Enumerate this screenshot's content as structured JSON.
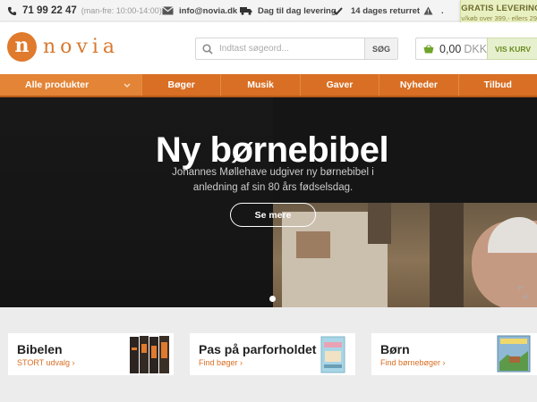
{
  "topbar": {
    "phone": "71 99 22 47",
    "hours": "(man-fre: 10:00-14:00)",
    "email": "info@novia.dk",
    "delivery": "Dag til dag levering",
    "returns": "14 dages returret",
    "extra": "."
  },
  "free_delivery": {
    "title": "GRATIS LEVERING",
    "subtitle": "v/køb over 399,- ellers 29,-"
  },
  "logo": {
    "mark": "n",
    "text": "novia"
  },
  "search": {
    "placeholder": "Indtast søgeord...",
    "button": "SØG"
  },
  "cart": {
    "amount": "0,00",
    "currency": "DKK",
    "button": "VIS KURV"
  },
  "nav": {
    "all_products": "Alle produkter",
    "links": [
      "Bøger",
      "Musik",
      "Gaver",
      "Nyheder",
      "Tilbud"
    ]
  },
  "hero": {
    "title": "Ny børnebibel",
    "subtitle_line1": "Johannes Møllehave udgiver ny børnebibel i",
    "subtitle_line2": "anledning af sin 80 års fødselsdag.",
    "button": "Se mere"
  },
  "promos": [
    {
      "title": "Bibelen",
      "link": "STORT udvalg ›"
    },
    {
      "title": "Pas på parforholdet",
      "link": "Find bøger ›"
    },
    {
      "title": "Børn",
      "link": "Find børnebøger ›"
    }
  ],
  "colors": {
    "brand_orange": "#d96f24",
    "cart_green": "#6a8a1e"
  },
  "icons": [
    "phone-icon",
    "mail-icon",
    "truck-icon",
    "check-icon",
    "warning-icon",
    "search-icon",
    "basket-icon",
    "chevron-down-icon",
    "expand-icon"
  ]
}
